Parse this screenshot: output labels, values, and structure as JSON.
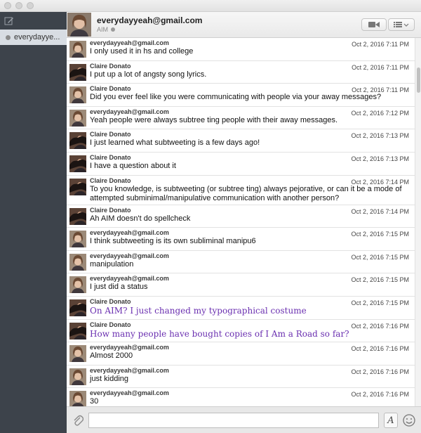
{
  "sidebar": {
    "items": [
      {
        "label": "everydayye..."
      }
    ]
  },
  "header": {
    "name": "everydayyeah@gmail.com",
    "service": "AIM"
  },
  "messages": [
    {
      "sender": "everydayyeah@gmail.com",
      "time": "Oct 2, 2016 7:11 PM",
      "text": "I only used it in hs and college",
      "who": "ev"
    },
    {
      "sender": "Claire Donato",
      "time": "Oct 2, 2016 7:11 PM",
      "text": "I put up a lot of angsty song lyrics.",
      "who": "cd"
    },
    {
      "sender": "Claire Donato",
      "time": "Oct 2, 2016 7:11 PM",
      "text": "Did you ever feel like you were communicating with people via your away messages?",
      "who": "ev"
    },
    {
      "sender": "everydayyeah@gmail.com",
      "time": "Oct 2, 2016 7:12 PM",
      "text": "Yeah people were always subtree ting people with their away messages.",
      "who": "ev"
    },
    {
      "sender": "Claire Donato",
      "time": "Oct 2, 2016 7:13 PM",
      "text": "I just learned what subtweeting is a few days ago!",
      "who": "cd"
    },
    {
      "sender": "Claire Donato",
      "time": "Oct 2, 2016 7:13 PM",
      "text": "I have a question about it",
      "who": "cd"
    },
    {
      "sender": "Claire Donato",
      "time": "Oct 2, 2016 7:14 PM",
      "text": "To you knowledge, is subtweeting (or subtree ting) always pejorative, or can it be a mode of attempted subminimal/manipulative communication with another person?",
      "who": "cd",
      "tall": true
    },
    {
      "sender": "Claire Donato",
      "time": "Oct 2, 2016 7:14 PM",
      "text": "Ah AIM doesn't do spellcheck",
      "who": "cd"
    },
    {
      "sender": "everydayyeah@gmail.com",
      "time": "Oct 2, 2016 7:15 PM",
      "text": "I think subtweeting is its own subliminal manipu6",
      "who": "ev"
    },
    {
      "sender": "everydayyeah@gmail.com",
      "time": "Oct 2, 2016 7:15 PM",
      "text": "manipulation",
      "who": "ev"
    },
    {
      "sender": "everydayyeah@gmail.com",
      "time": "Oct 2, 2016 7:15 PM",
      "text": "I just did a status",
      "who": "ev"
    },
    {
      "sender": "Claire Donato",
      "time": "Oct 2, 2016 7:15 PM",
      "text": "On AIM? I just changed my typographical costume",
      "who": "cd",
      "serif": true
    },
    {
      "sender": "Claire Donato",
      "time": "Oct 2, 2016 7:16 PM",
      "text": "How many people have bought copies of I Am a Road so far?",
      "who": "cd",
      "serif": true
    },
    {
      "sender": "everydayyeah@gmail.com",
      "time": "Oct 2, 2016 7:16 PM",
      "text": "Almost 2000",
      "who": "ev"
    },
    {
      "sender": "everydayyeah@gmail.com",
      "time": "Oct 2, 2016 7:16 PM",
      "text": "just kidding",
      "who": "ev"
    },
    {
      "sender": "everydayyeah@gmail.com",
      "time": "Oct 2, 2016 7:16 PM",
      "text": "30",
      "who": "ev"
    }
  ],
  "composer": {
    "value": "",
    "format_label": "A"
  },
  "colors": {
    "sidebar": "#3d434b",
    "formatted_text": "#6a2fb0"
  }
}
